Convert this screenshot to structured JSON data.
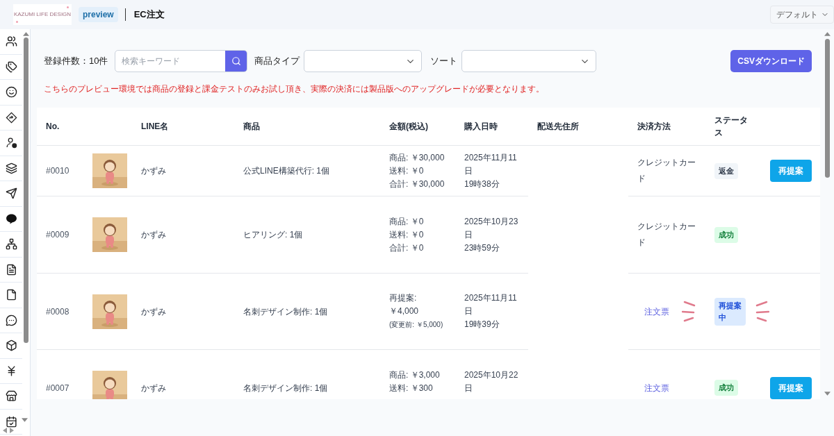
{
  "header": {
    "logo_text": "KAZUMI LIFE DESIGN",
    "env_badge": "preview",
    "title": "EC注文",
    "view_select": "デフォルト"
  },
  "sidebar": {
    "icons": [
      {
        "kind": "users"
      },
      {
        "kind": "tags"
      },
      {
        "kind": "smile"
      },
      {
        "kind": "sign"
      },
      {
        "kind": "user-c"
      },
      {
        "kind": "layers"
      },
      {
        "kind": "send"
      },
      {
        "kind": "line"
      },
      {
        "kind": "network"
      },
      {
        "kind": "list"
      },
      {
        "kind": "file"
      },
      {
        "kind": "chat"
      },
      {
        "kind": "box"
      },
      {
        "kind": "yen"
      },
      {
        "kind": "store"
      },
      {
        "kind": "calendar"
      }
    ]
  },
  "toolbar": {
    "count_label": "登録件数：10件",
    "search": {
      "placeholder": "検索キーワード"
    },
    "type_label": "商品タイプ",
    "sort_label": "ソート",
    "csv_button": "CSVダウンロード"
  },
  "notice": "こちらのプレビュー環境では商品の登録と課金テストのみお試し頂き、実際の決済には製品版へのアップグレードが必要となります。",
  "table": {
    "columns": [
      "No.",
      "LINE名",
      "商品",
      "金額(税込)",
      "購入日時",
      "配送先住所",
      "決済方法",
      "ステータス"
    ],
    "rows": [
      {
        "no": "#0010",
        "thumbnail": {
          "kind": "picture"
        },
        "line_name": "かずみ",
        "product": "公式LINE構築代行: 1個",
        "amount_lines": [
          "商品: ￥30,000",
          "送料: ￥0",
          "合計: ￥30,000"
        ],
        "date_lines": [
          "2025年11月11",
          "日",
          "19時38分"
        ],
        "payment": {
          "kind": "text",
          "lines": [
            "クレジットカー",
            "ド"
          ]
        },
        "status": {
          "kind": "refund",
          "lines": [
            "返金"
          ]
        },
        "action": "再提案",
        "highlighted": false
      },
      {
        "no": "#0009",
        "thumbnail": {
          "kind": "picture"
        },
        "line_name": "かずみ",
        "product": "ヒアリング: 1個",
        "amount_lines": [
          "商品: ￥0",
          "送料: ￥0",
          "合計: ￥0"
        ],
        "date_lines": [
          "2025年10月23",
          "日",
          "23時59分"
        ],
        "payment": {
          "kind": "text",
          "lines": [
            "クレジットカー",
            "ド"
          ]
        },
        "status": {
          "kind": "success",
          "lines": [
            "成功"
          ]
        },
        "highlighted": false
      },
      {
        "no": "#0008",
        "thumbnail": {
          "kind": "picture"
        },
        "line_name": "かずみ",
        "product": "名刺デザイン制作: 1個",
        "amount_lines": [
          "再提案:",
          "￥4,000"
        ],
        "amount_note": "(変更前: ￥5,000)",
        "date_lines": [
          "2025年11月11",
          "日",
          "19時39分"
        ],
        "payment": {
          "kind": "link",
          "lines": [
            "注文票"
          ]
        },
        "status": {
          "kind": "reproposal",
          "lines": [
            "再提案",
            "中"
          ]
        },
        "highlighted": true
      },
      {
        "no": "#0007",
        "thumbnail": {
          "kind": "picture"
        },
        "line_name": "かずみ",
        "product": "名刺デザイン制作: 1個",
        "amount_lines": [
          "商品: ￥3,000",
          "送料: ￥300"
        ],
        "date_lines": [
          "2025年10月22",
          "日"
        ],
        "payment": {
          "kind": "link",
          "lines": [
            "注文票"
          ]
        },
        "status": {
          "kind": "success",
          "lines": [
            "成功"
          ]
        },
        "action": "再提案",
        "highlighted": false
      }
    ]
  }
}
